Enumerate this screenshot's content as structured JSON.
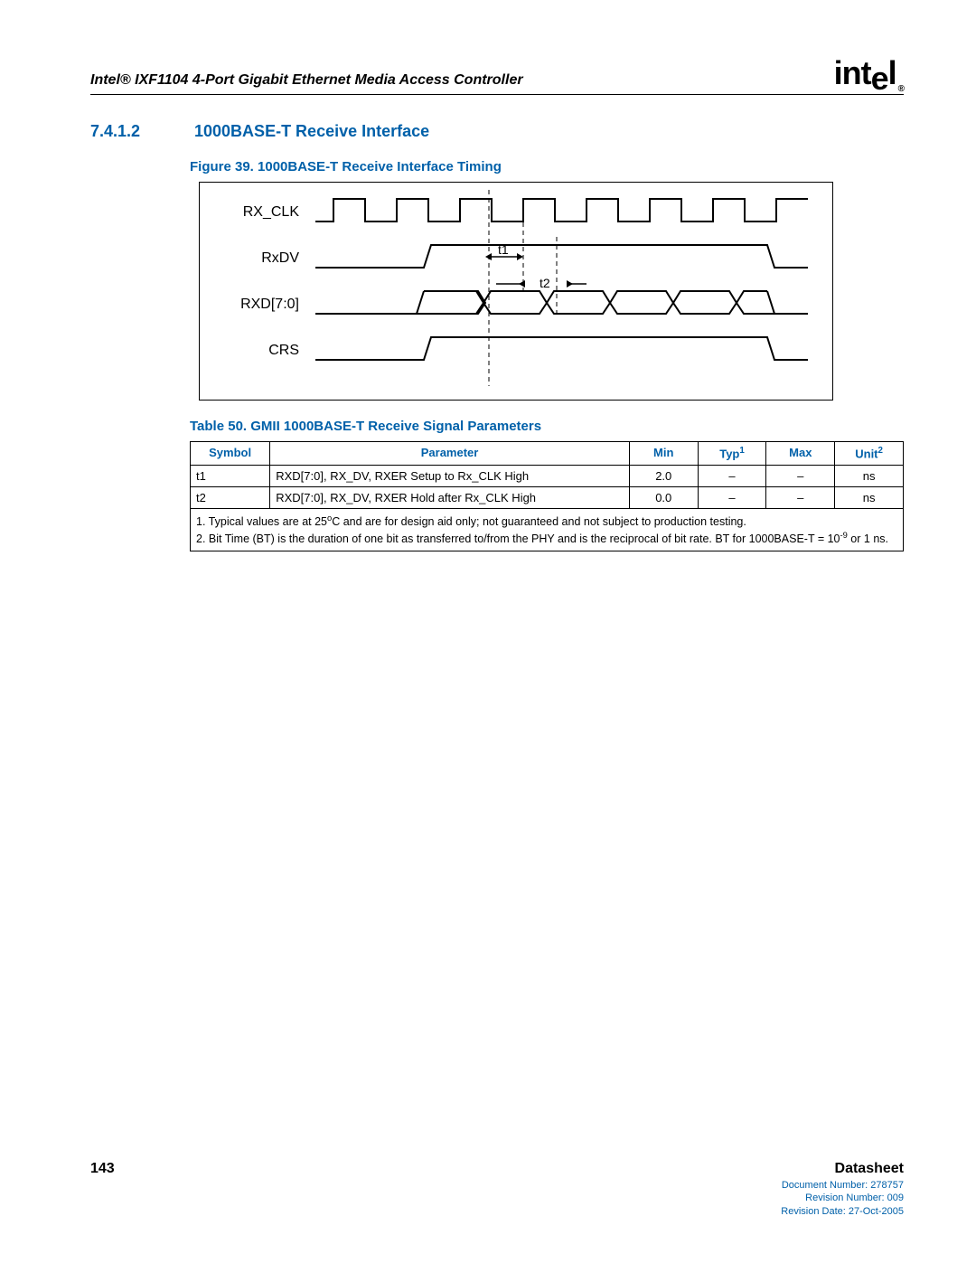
{
  "header": {
    "title": "Intel® IXF1104 4-Port Gigabit Ethernet Media Access Controller",
    "logo_text": "intel",
    "logo_reg": "®"
  },
  "section": {
    "number": "7.4.1.2",
    "title": "1000BASE-T Receive Interface"
  },
  "figure": {
    "caption": "Figure 39. 1000BASE-T Receive Interface Timing",
    "signals": [
      "RX_CLK",
      "RxDV",
      "RXD[7:0]",
      "CRS"
    ],
    "markers": {
      "t1": "t1",
      "t2": "t2"
    }
  },
  "table": {
    "caption": "Table 50.  GMII 1000BASE-T Receive Signal Parameters",
    "headers": {
      "symbol": "Symbol",
      "parameter": "Parameter",
      "min": "Min",
      "typ": "Typ",
      "typ_sup": "1",
      "max": "Max",
      "unit": "Unit",
      "unit_sup": "2"
    },
    "rows": [
      {
        "symbol": "t1",
        "parameter": "RXD[7:0], RX_DV, RXER Setup to Rx_CLK High",
        "min": "2.0",
        "typ": "–",
        "max": "–",
        "unit": "ns"
      },
      {
        "symbol": "t2",
        "parameter": "RXD[7:0], RX_DV, RXER Hold after Rx_CLK High",
        "min": "0.0",
        "typ": "–",
        "max": "–",
        "unit": "ns"
      }
    ],
    "notes": {
      "n1a": "1. Typical values are at 25",
      "n1deg": "o",
      "n1b": "C and are for design aid only; not guaranteed and not subject to production testing.",
      "n2a": "2. Bit Time (BT) is the duration of one bit as transferred to/from the PHY and is the reciprocal of bit rate. BT for 1000BASE-T = 10",
      "n2exp": "-9",
      "n2b": " or 1 ns."
    }
  },
  "footer": {
    "page": "143",
    "datasheet": "Datasheet",
    "doc_number": "Document Number: 278757",
    "rev_number": "Revision Number: 009",
    "rev_date": "Revision Date: 27-Oct-2005"
  }
}
